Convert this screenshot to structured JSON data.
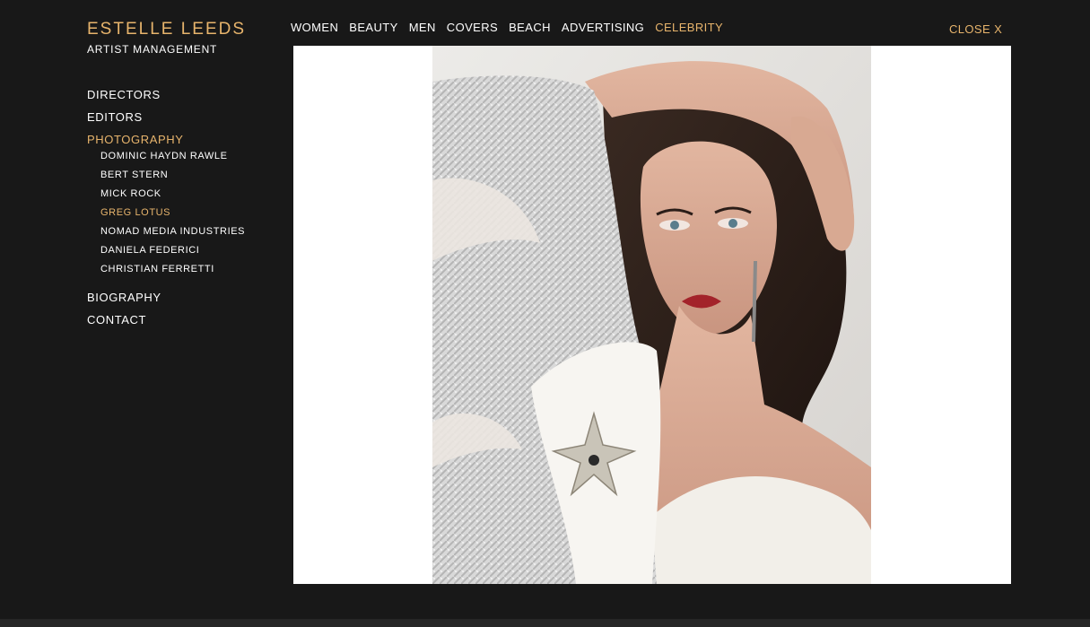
{
  "brand": {
    "name": "ESTELLE LEEDS",
    "subtitle": "ARTIST MANAGEMENT"
  },
  "sidebar": {
    "items": [
      {
        "label": "DIRECTORS"
      },
      {
        "label": "EDITORS"
      },
      {
        "label": "PHOTOGRAPHY",
        "active": true
      }
    ],
    "photographers": [
      {
        "label": "DOMINIC HAYDN RAWLE"
      },
      {
        "label": "BERT STERN"
      },
      {
        "label": "MICK ROCK"
      },
      {
        "label": "GREG LOTUS",
        "active": true
      },
      {
        "label": "NOMAD MEDIA INDUSTRIES"
      },
      {
        "label": "DANIELA FEDERICI"
      },
      {
        "label": "CHRISTIAN FERRETTI"
      }
    ],
    "footer_items": [
      {
        "label": "BIOGRAPHY"
      },
      {
        "label": "CONTACT"
      }
    ]
  },
  "top_nav": {
    "items": [
      {
        "label": "WOMEN"
      },
      {
        "label": "BEAUTY"
      },
      {
        "label": "MEN"
      },
      {
        "label": "COVERS"
      },
      {
        "label": "BEACH"
      },
      {
        "label": "ADVERTISING"
      },
      {
        "label": "CELEBRITY",
        "active": true
      }
    ]
  },
  "close": {
    "label": "CLOSE X"
  },
  "colors": {
    "background": "#181818",
    "accent": "#e7b46c",
    "text": "#ffffff",
    "panel": "#ffffff"
  }
}
